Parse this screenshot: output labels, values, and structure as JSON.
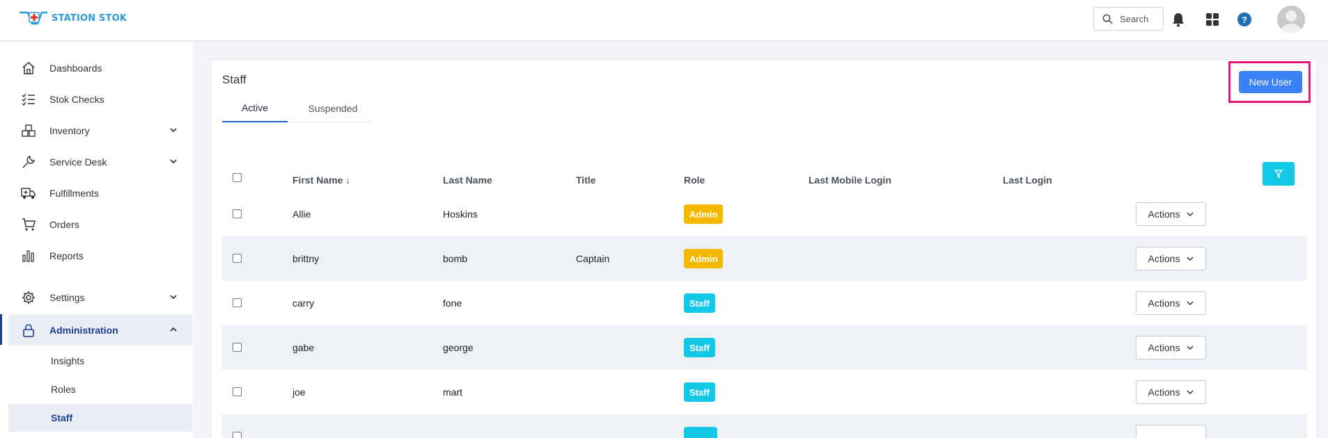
{
  "app": {
    "logo_text": "STATION STOK"
  },
  "topbar": {
    "search_label": "Search",
    "icons": [
      "search-icon",
      "bell-icon",
      "apps-grid-icon",
      "help-icon",
      "avatar"
    ],
    "help_glyph": "?"
  },
  "colors": {
    "primary": "#3b82f6",
    "brand": "#2a9bd6",
    "admin_badge": "#f5b800",
    "staff_badge": "#14c8e8",
    "highlight": "#e8167a",
    "nav_active": "#1d3f8f"
  },
  "sidebar": {
    "items": [
      {
        "label": "Dashboards",
        "icon": "home-icon"
      },
      {
        "label": "Stok Checks",
        "icon": "checklist-icon"
      },
      {
        "label": "Inventory",
        "icon": "boxes-icon"
      },
      {
        "label": "Service Desk",
        "icon": "wrench-icon"
      },
      {
        "label": "Fulfillments",
        "icon": "truck-icon"
      },
      {
        "label": "Orders",
        "icon": "cart-icon"
      },
      {
        "label": "Reports",
        "icon": "bar-chart-icon"
      },
      {
        "label": "Settings",
        "icon": "gear-icon"
      },
      {
        "label": "Administration",
        "icon": "lock-icon"
      }
    ],
    "sub_items": [
      {
        "label": "Insights"
      },
      {
        "label": "Roles"
      },
      {
        "label": "Staff"
      }
    ]
  },
  "main": {
    "title": "Staff",
    "new_user_label": "New User",
    "tabs": [
      {
        "label": "Active"
      },
      {
        "label": "Suspended"
      }
    ],
    "columns": [
      "First Name ↓",
      "Last Name",
      "Title",
      "Role",
      "Last Mobile Login",
      "Last Login"
    ],
    "actions_label": "Actions",
    "rows": [
      {
        "first": "Allie",
        "last": "Hoskins",
        "title": "",
        "role": "Admin"
      },
      {
        "first": "brittny",
        "last": "bomb",
        "title": "Captain",
        "role": "Admin"
      },
      {
        "first": "carry",
        "last": "fone",
        "title": "",
        "role": "Staff"
      },
      {
        "first": "gabe",
        "last": "george",
        "title": "",
        "role": "Staff"
      },
      {
        "first": "joe",
        "last": "mart",
        "title": "",
        "role": "Staff"
      }
    ]
  }
}
